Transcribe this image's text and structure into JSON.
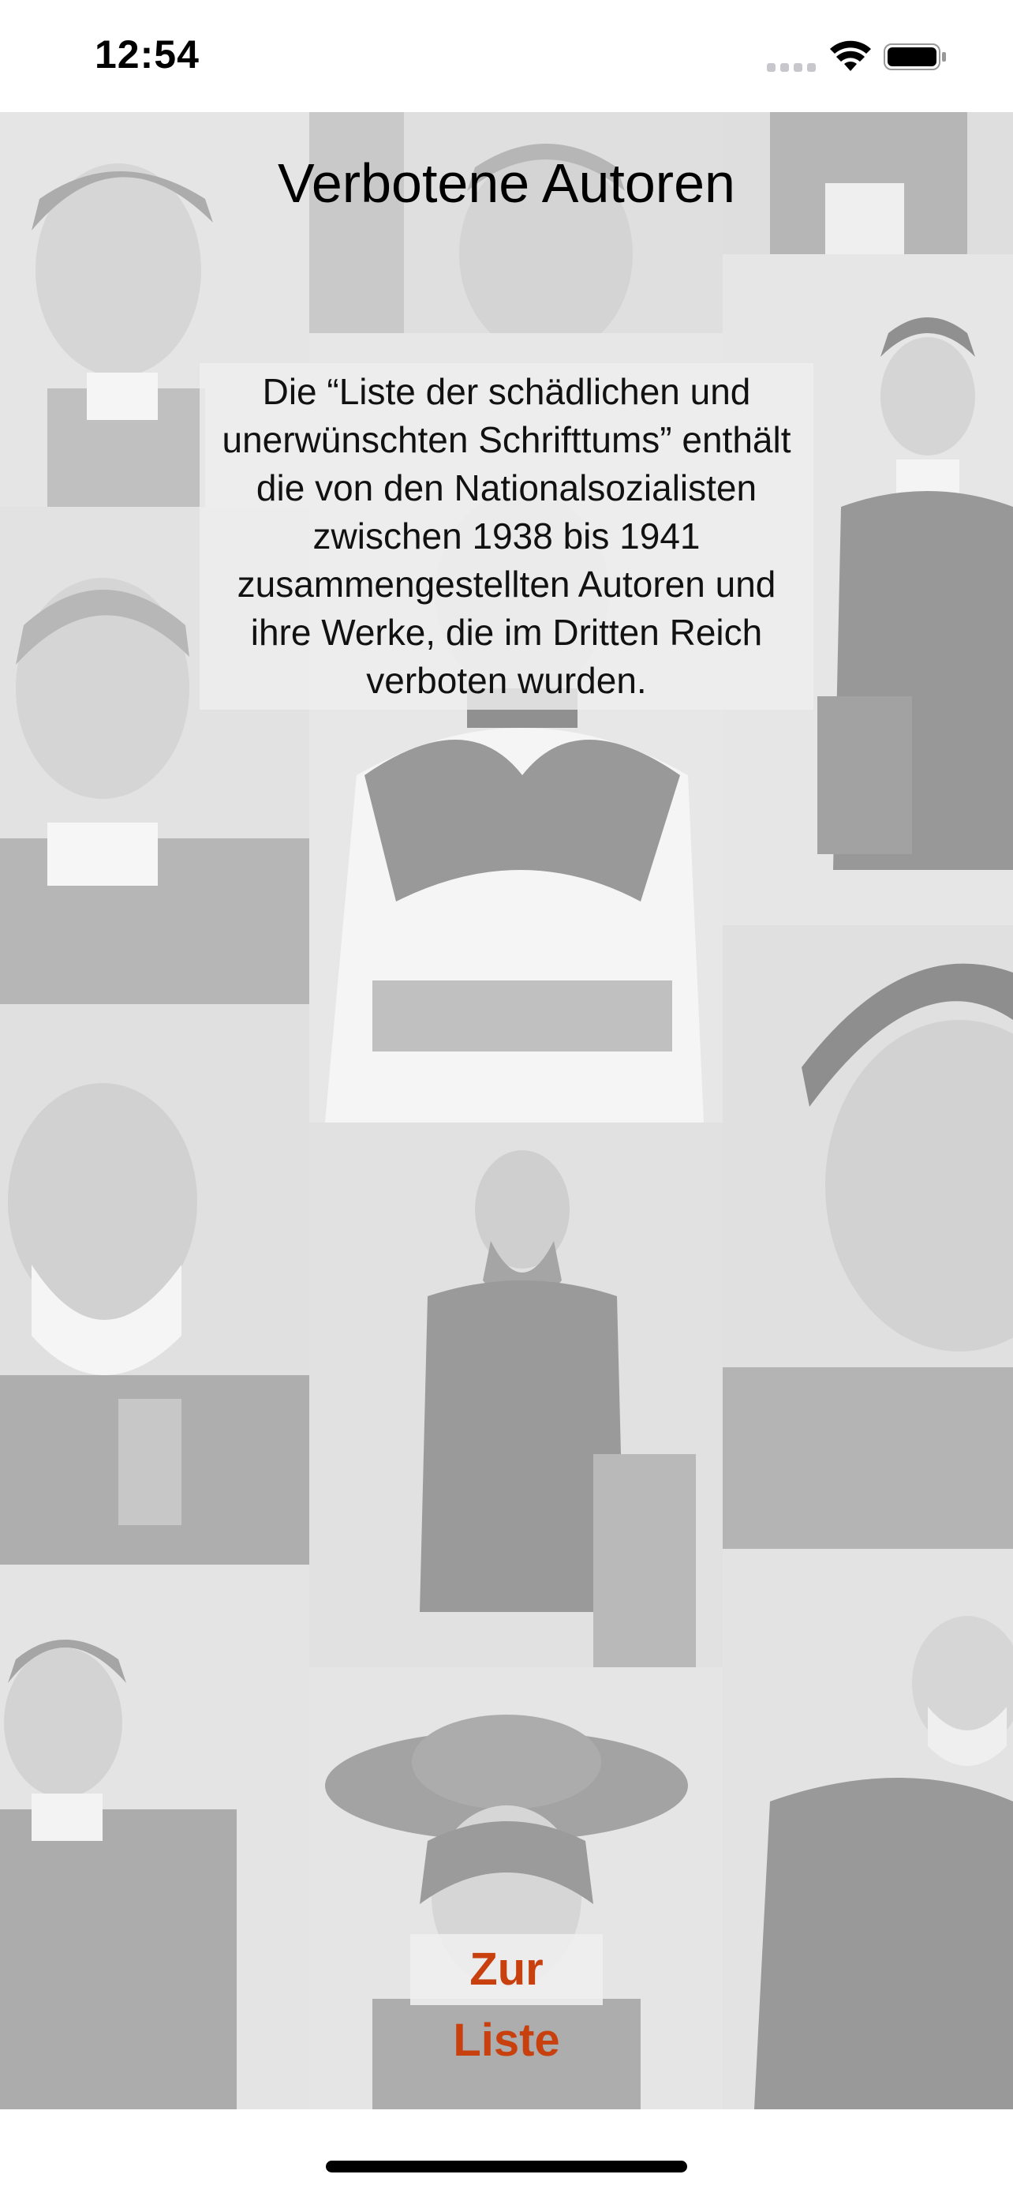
{
  "status_bar": {
    "time": "12:54",
    "icons": [
      "cellular-signal-icon",
      "wifi-icon",
      "battery-icon"
    ]
  },
  "main": {
    "title": "Verbotene Autoren",
    "intro": "Die “Liste der schädlichen und unerwünschten Schrifttums” enthält die von den Nationalsozialisten zwischen 1938 bis 1941 zusammengestellten Autoren und ihre Werke, die im Dritten Reich verboten wurden.",
    "cta_label": "Zur Liste"
  },
  "colors": {
    "accent": "#c8400e",
    "background": "#ffffff",
    "text": "#000000"
  }
}
